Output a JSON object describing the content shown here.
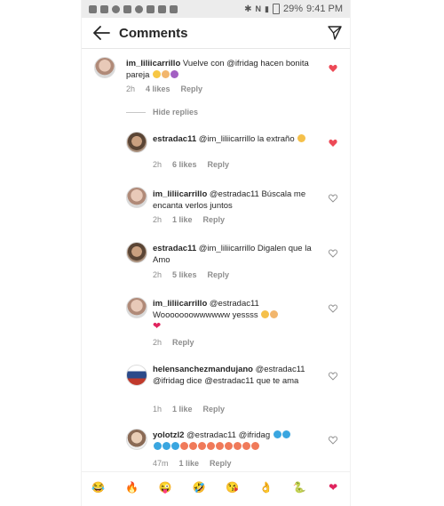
{
  "statusbar": {
    "battery": "29%",
    "time": "9:41 PM"
  },
  "header": {
    "title": "Comments"
  },
  "comments": [
    {
      "username": "im_liliicarrillo",
      "text": "Vuelve con @ifridag hacen bonita pareja",
      "time": "2h",
      "likes": "4 likes",
      "reply": "Reply",
      "liked": true
    },
    {
      "username": "estradac11",
      "text": "@im_liliicarrillo la extraño",
      "time": "2h",
      "likes": "6 likes",
      "reply": "Reply",
      "liked": true
    },
    {
      "username": "im_liliicarrillo",
      "text": "@estradac11 Búscala me encanta verlos juntos",
      "time": "2h",
      "likes": "1 like",
      "reply": "Reply",
      "liked": false
    },
    {
      "username": "estradac11",
      "text": "@im_liliicarrillo Digalen que la Amo",
      "time": "2h",
      "likes": "5 likes",
      "reply": "Reply",
      "liked": false
    },
    {
      "username": "im_liliicarrillo",
      "text": "@estradac11 Wooooooowwwwww yessss",
      "time": "2h",
      "likes": "",
      "reply": "Reply",
      "liked": false
    },
    {
      "username": "helensanchezmandujano",
      "text": "@estradac11 @ifridag dice @estradac11 que te ama",
      "time": "1h",
      "likes": "1 like",
      "reply": "Reply",
      "liked": false
    },
    {
      "username": "yolotzl2",
      "text": "@estradac11 @ifridag",
      "time": "47m",
      "likes": "1 like",
      "reply": "Reply",
      "liked": false
    }
  ],
  "hide_replies": "Hide replies",
  "emoji_bar": [
    "😂",
    "🔥",
    "😜",
    "🤣",
    "😘",
    "👌",
    "🐍",
    "❤"
  ],
  "colors": {
    "heart_red": "#ed4956",
    "meta_gray": "#8e8e8e",
    "text": "#262626"
  }
}
